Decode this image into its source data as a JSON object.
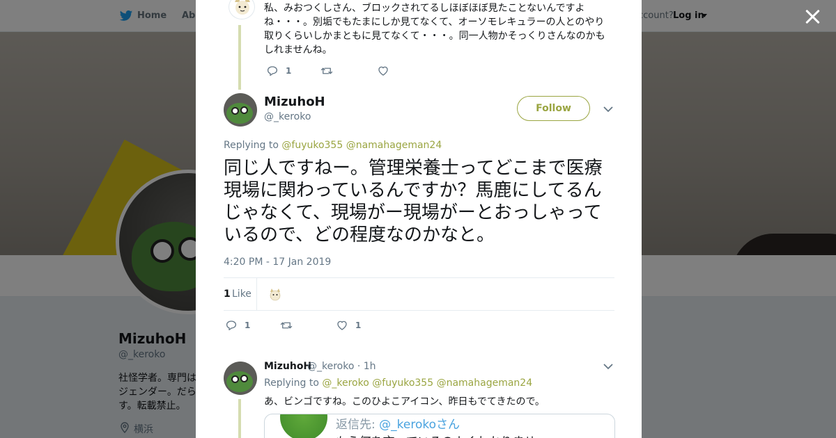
{
  "nav": {
    "home_label": "Home",
    "about_label": "Abo",
    "account_prompt": "ccount?",
    "login_label": "Log in"
  },
  "profile": {
    "name": "MizuhoH",
    "handle": "@_keroko",
    "bio": "社怪学者。専門は\nジェンダー。だら\nす。転載禁止。",
    "location": "横浜"
  },
  "previous_tweet": {
    "text": "私、みおつくしさん、ブロックされてるしほぼほぼ見たことないんですよね・・・。別垢でもたまにしか見てなくて、オーソモレキュラーの人とのやり取りくらいしかまともに見てなくて・・・。同一人物かそっくりさんなのかもしれませんね。",
    "reply_count": "1"
  },
  "main_tweet": {
    "name": "MizuhoH",
    "handle": "@_keroko",
    "follow_label": "Follow",
    "replying_prefix": "Replying to",
    "replying_mentions": [
      "@fuyuko355",
      "@namahageman24"
    ],
    "text": "同じ人ですねー。管理栄養士ってどこまで医療現場に関わっているんですか？馬鹿にしてるんじゃなくて、現場がー現場がーとおっしゃっているので、どの程度なのかなと。",
    "timestamp": "4:20 PM - 17 Jan 2019",
    "likes_count": "1",
    "likes_label": "Like",
    "reply_count": "1",
    "like_count_action": "1"
  },
  "reply_tweet": {
    "name": "MizuhoH",
    "handle": "@_keroko",
    "time": "· 1h",
    "replying_prefix": "Replying to",
    "replying_mentions": [
      "@_keroko",
      "@fuyuko355",
      "@namahageman24"
    ],
    "text": "あ、ビンゴですね。このひよこアイコン、昨日もでてきたので。",
    "quote_line1_prefix": "返信先: ",
    "quote_line1_mention": "@_kerokoさん",
    "quote_line2": "もう何を言っているのよくわかりませ"
  },
  "colors": {
    "accent": "#9aa541",
    "text_secondary": "#657786",
    "overlay": "rgba(0,0,0,0.5)"
  },
  "icons": [
    "twitter-bird-icon",
    "close-icon",
    "reply-icon",
    "retweet-icon",
    "heart-icon",
    "chevron-down-icon",
    "location-pin-icon"
  ]
}
